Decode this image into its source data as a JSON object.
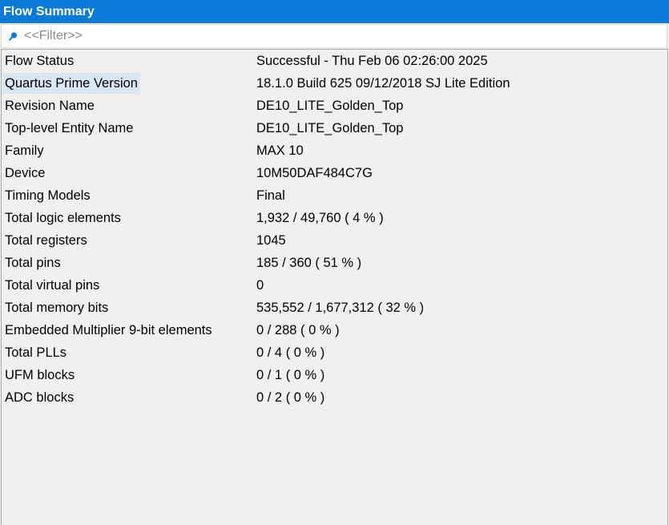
{
  "window": {
    "title": "Flow Summary"
  },
  "filter": {
    "placeholder": "<<Filter>>",
    "value": ""
  },
  "rows": [
    {
      "label": "Flow Status",
      "value": "Successful - Thu Feb 06 02:26:00 2025"
    },
    {
      "label": "Quartus Prime Version",
      "value": "18.1.0 Build 625 09/12/2018 SJ Lite Edition"
    },
    {
      "label": "Revision Name",
      "value": "DE10_LITE_Golden_Top"
    },
    {
      "label": "Top-level Entity Name",
      "value": "DE10_LITE_Golden_Top"
    },
    {
      "label": "Family",
      "value": "MAX 10"
    },
    {
      "label": "Device",
      "value": "10M50DAF484C7G"
    },
    {
      "label": "Timing Models",
      "value": "Final"
    },
    {
      "label": "Total logic elements",
      "value": "1,932 / 49,760 ( 4 % )"
    },
    {
      "label": "Total registers",
      "value": "1045"
    },
    {
      "label": "Total pins",
      "value": "185 / 360 ( 51 % )"
    },
    {
      "label": "Total virtual pins",
      "value": "0"
    },
    {
      "label": "Total memory bits",
      "value": "535,552 / 1,677,312 ( 32 % )"
    },
    {
      "label": "Embedded Multiplier 9-bit elements",
      "value": "0 / 288 ( 0 % )"
    },
    {
      "label": "Total PLLs",
      "value": "0 / 4 ( 0 % )"
    },
    {
      "label": "UFM blocks",
      "value": "0 / 1 ( 0 % )"
    },
    {
      "label": "ADC blocks",
      "value": "0 / 2 ( 0 % )"
    }
  ],
  "selected_row": 1,
  "colors": {
    "titlebar": "#0a7ad6",
    "selection": "#d9e6f3",
    "search_icon": "#0a7ad6"
  },
  "icons": {
    "filter": "search-icon"
  }
}
